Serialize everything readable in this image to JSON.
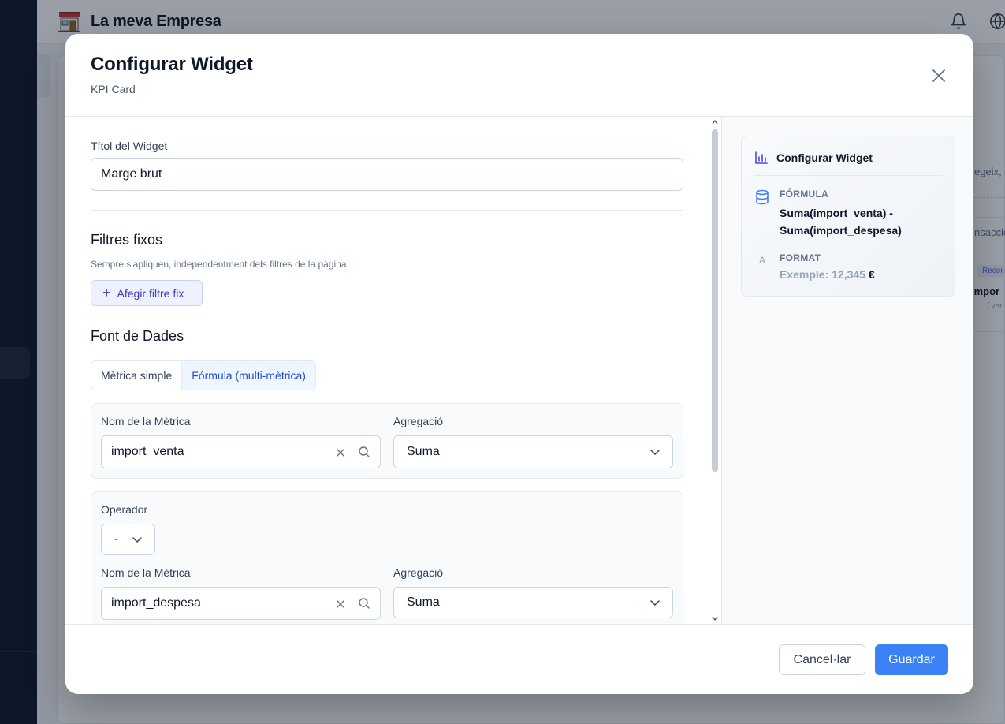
{
  "app": {
    "name": "La meva Empresa"
  },
  "background": {
    "text1": "egeix, e",
    "text2": "nsacció",
    "badge": "Recor",
    "text3": "impor",
    "text4": "/ ver"
  },
  "modal": {
    "title": "Configurar Widget",
    "subtitle": "KPI Card",
    "fields": {
      "widget_title": {
        "label": "Títol del Widget",
        "value": "Marge brut"
      }
    },
    "fixed_filters": {
      "title": "Filtres fixos",
      "hint": "Sempre s'apliquen, independentment dels filtres de la pàgina.",
      "add_button": "Afegir filtre fix"
    },
    "data_source": {
      "title": "Font de Dades",
      "tabs": [
        {
          "label": "Mètrica simple",
          "active": false
        },
        {
          "label": "Fórmula (multi-mètrica)",
          "active": true
        }
      ],
      "metric1": {
        "name_label": "Nom de la Mètrica",
        "name_value": "import_venta",
        "agg_label": "Agregació",
        "agg_value": "Suma"
      },
      "operator": {
        "label": "Operador",
        "value": "-"
      },
      "metric2": {
        "name_label": "Nom de la Mètrica",
        "name_value": "import_despesa",
        "agg_label": "Agregació",
        "agg_value": "Suma"
      }
    },
    "preview": {
      "title": "Configurar Widget",
      "formula_label": "FÓRMULA",
      "formula": "Suma(import_venta) - Suma(import_despesa)",
      "format_label": "FORMAT",
      "format_icon_letter": "A",
      "example_prefix": "Exemple: 12,345",
      "example_currency": "€"
    },
    "footer": {
      "cancel": "Cancel·lar",
      "save": "Guardar"
    }
  },
  "colors": {
    "primary": "#3b82f6",
    "accent_indigo": "#4338ca",
    "overlay": "#0f172a"
  }
}
